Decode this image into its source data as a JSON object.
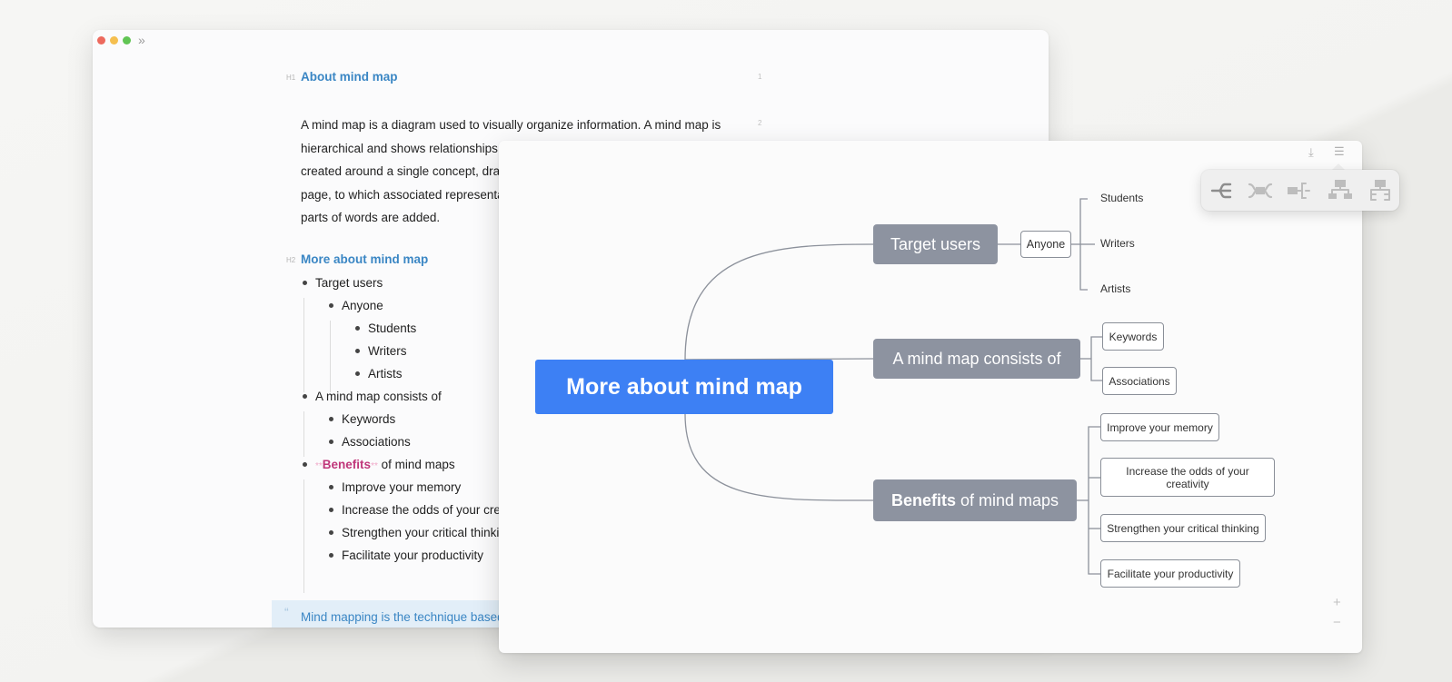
{
  "editor": {
    "h1_tag": "H1",
    "h1": "About mind map",
    "line_numbers": [
      "1",
      "2"
    ],
    "paragraph_lines": [
      "A mind map is a diagram used to visually organize information. A mind map is",
      "hierarchical and shows relationships a",
      "created around a single concept, draw",
      "page, to which associated representat",
      "parts of words are added."
    ],
    "h2_tag": "H2",
    "h2": "More about mind map",
    "list": {
      "target_users": "Target users",
      "anyone": "Anyone",
      "students": "Students",
      "writers": "Writers",
      "artists": "Artists",
      "consists": "A mind map consists of",
      "keywords": "Keywords",
      "associations": "Associations",
      "benefits_marks_open": "**",
      "benefits_strong": "Benefits",
      "benefits_marks_close": "**",
      "benefits_rest": " of mind maps",
      "memory": "Improve your memory",
      "odds": "Increase the odds of your crea",
      "critical": "Strengthen your critical thinki",
      "productivity": "Facilitate your productivity"
    },
    "quote_mark": "“",
    "quote": "Mind mapping is the technique based"
  },
  "mindmap": {
    "root": "More about mind map",
    "target_users": "Target users",
    "anyone": "Anyone",
    "students": "Students",
    "writers": "Writers",
    "artists": "Artists",
    "consists": "A mind map consists of",
    "keywords": "Keywords",
    "associations": "Associations",
    "benefits_strong": "Benefits",
    "benefits_rest": " of mind maps",
    "memory": "Improve your memory",
    "odds": "Increase the odds of your creativity",
    "critical": "Strengthen your critical thinking",
    "productivity": "Facilitate your productivity",
    "zoom_in": "+",
    "zoom_out": "−"
  },
  "icons": {
    "close": "red-dot",
    "minimize": "yellow-dot",
    "maximize": "green-dot",
    "expand": "double-chevron-right-icon",
    "export": "download-icon",
    "layout": "list-icon"
  },
  "colors": {
    "accent_blue": "#3d80f4",
    "heading_blue": "#3a86c4",
    "node_gray": "#8d93a0",
    "bold_pink": "#c0367a"
  }
}
